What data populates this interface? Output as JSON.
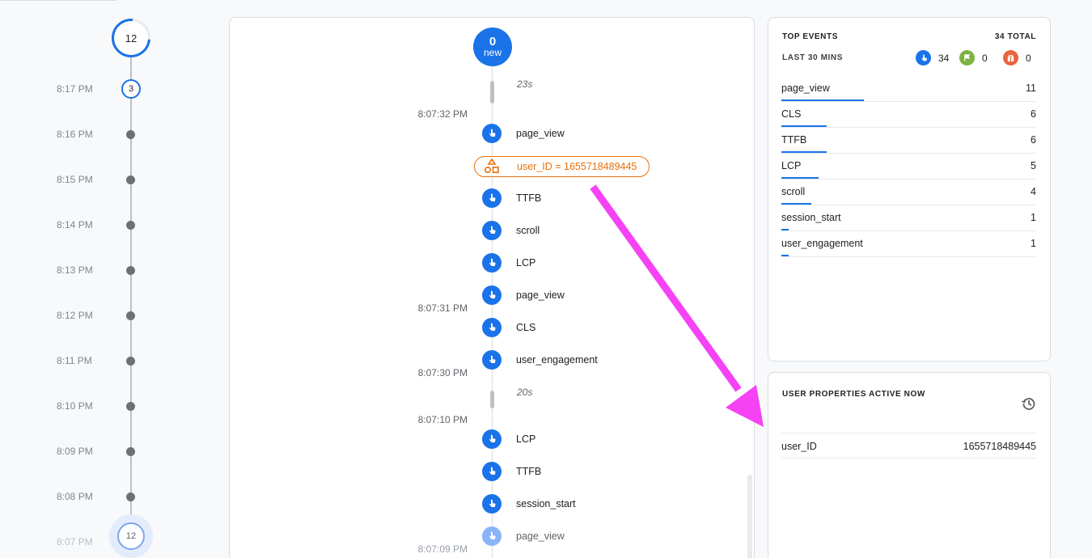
{
  "minutes": {
    "top_count": "12",
    "rows": [
      {
        "time": "8:17 PM",
        "count": "3"
      },
      {
        "time": "8:16 PM"
      },
      {
        "time": "8:15 PM"
      },
      {
        "time": "8:14 PM"
      },
      {
        "time": "8:13 PM"
      },
      {
        "time": "8:12 PM"
      },
      {
        "time": "8:11 PM"
      },
      {
        "time": "8:10 PM"
      },
      {
        "time": "8:09 PM"
      },
      {
        "time": "8:08 PM"
      },
      {
        "time": "8:07 PM",
        "count": "12"
      }
    ]
  },
  "stream": {
    "new_count": "0",
    "new_label": "new",
    "gaps": [
      "23s",
      "20s"
    ],
    "times": [
      "8:07:32 PM",
      "8:07:31 PM",
      "8:07:30 PM",
      "8:07:10 PM",
      "8:07:09 PM"
    ],
    "property_pill": "user_ID = 1655718489445",
    "events": [
      "page_view",
      "TTFB",
      "scroll",
      "LCP",
      "page_view",
      "CLS",
      "user_engagement",
      "LCP",
      "TTFB",
      "session_start",
      "page_view"
    ]
  },
  "top_events": {
    "title": "TOP EVENTS",
    "total": "34 TOTAL",
    "period": "LAST 30 MINS",
    "counts": {
      "events": "34",
      "conversions": "0",
      "errors": "0"
    },
    "items": [
      {
        "name": "page_view",
        "value": "11",
        "share": 0.3235
      },
      {
        "name": "CLS",
        "value": "6",
        "share": 0.1765
      },
      {
        "name": "TTFB",
        "value": "6",
        "share": 0.1765
      },
      {
        "name": "LCP",
        "value": "5",
        "share": 0.147
      },
      {
        "name": "scroll",
        "value": "4",
        "share": 0.1176
      },
      {
        "name": "session_start",
        "value": "1",
        "share": 0.0294
      },
      {
        "name": "user_engagement",
        "value": "1",
        "share": 0.0294
      }
    ]
  },
  "user_properties": {
    "title": "USER PROPERTIES ACTIVE NOW",
    "items": [
      {
        "key": "user_ID",
        "value": "1655718489445"
      }
    ]
  },
  "colors": {
    "accent": "#1a73e8",
    "conversion": "#7cb342",
    "error": "#e8643c",
    "property": "#e8710a",
    "annotation": "#f542f5"
  }
}
